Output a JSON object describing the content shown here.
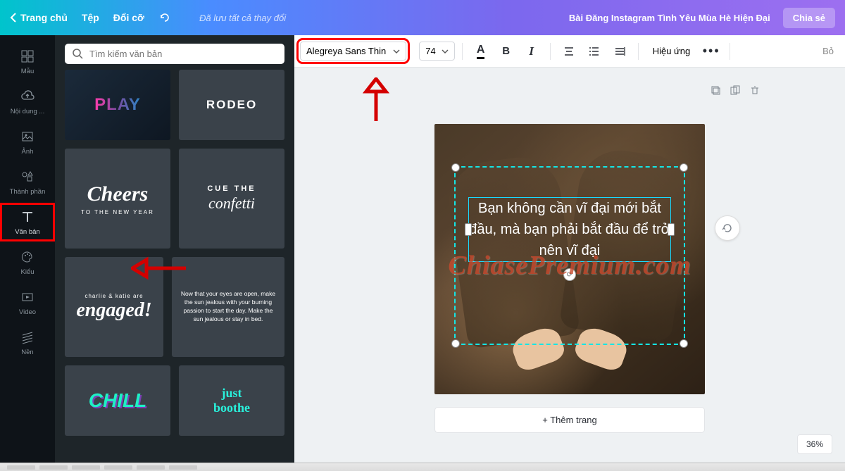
{
  "header": {
    "home": "Trang chủ",
    "file": "Tệp",
    "resize": "Đổi cỡ",
    "saved": "Đã lưu tất cả thay đổi",
    "title": "Bài Đăng Instagram Tình Yêu Mùa Hè Hiện Đại",
    "share": "Chia sẻ"
  },
  "rail": {
    "templates": "Mẫu",
    "uploads": "Nội dung ...",
    "photos": "Ảnh",
    "elements": "Thành phần",
    "text": "Văn bản",
    "styles": "Kiểu",
    "video": "Video",
    "bkground": "Nền"
  },
  "panel": {
    "search_placeholder": "Tìm kiếm văn bản",
    "thumbs": {
      "play": "PLAY",
      "rodeo": "RODEO",
      "cheers": "Cheers",
      "cheers_sub": "TO THE NEW YEAR",
      "cue1": "CUE THE",
      "cue2": "confetti",
      "engaged_top": "charlie & katie are",
      "engaged": "engaged!",
      "sunpara": "Now that your eyes are open, make the sun jealous with your burning passion to start the day. Make the sun jealous or stay in bed.",
      "chill": "CHILL",
      "just": "just\nboothe"
    }
  },
  "toolbar": {
    "font": "Alegreya Sans Thin",
    "size": "74",
    "color": "A",
    "bold": "B",
    "italic": "I",
    "effects": "Hiệu ứng",
    "bo": "Bỏ"
  },
  "canvas": {
    "text_content": "Bạn không cần vĩ đại mới bắt đầu, mà bạn phải bắt đầu để trở nên vĩ đại",
    "watermark": "ChiasePremium.com",
    "add_page": "+ Thêm trang",
    "zoom": "36%"
  }
}
